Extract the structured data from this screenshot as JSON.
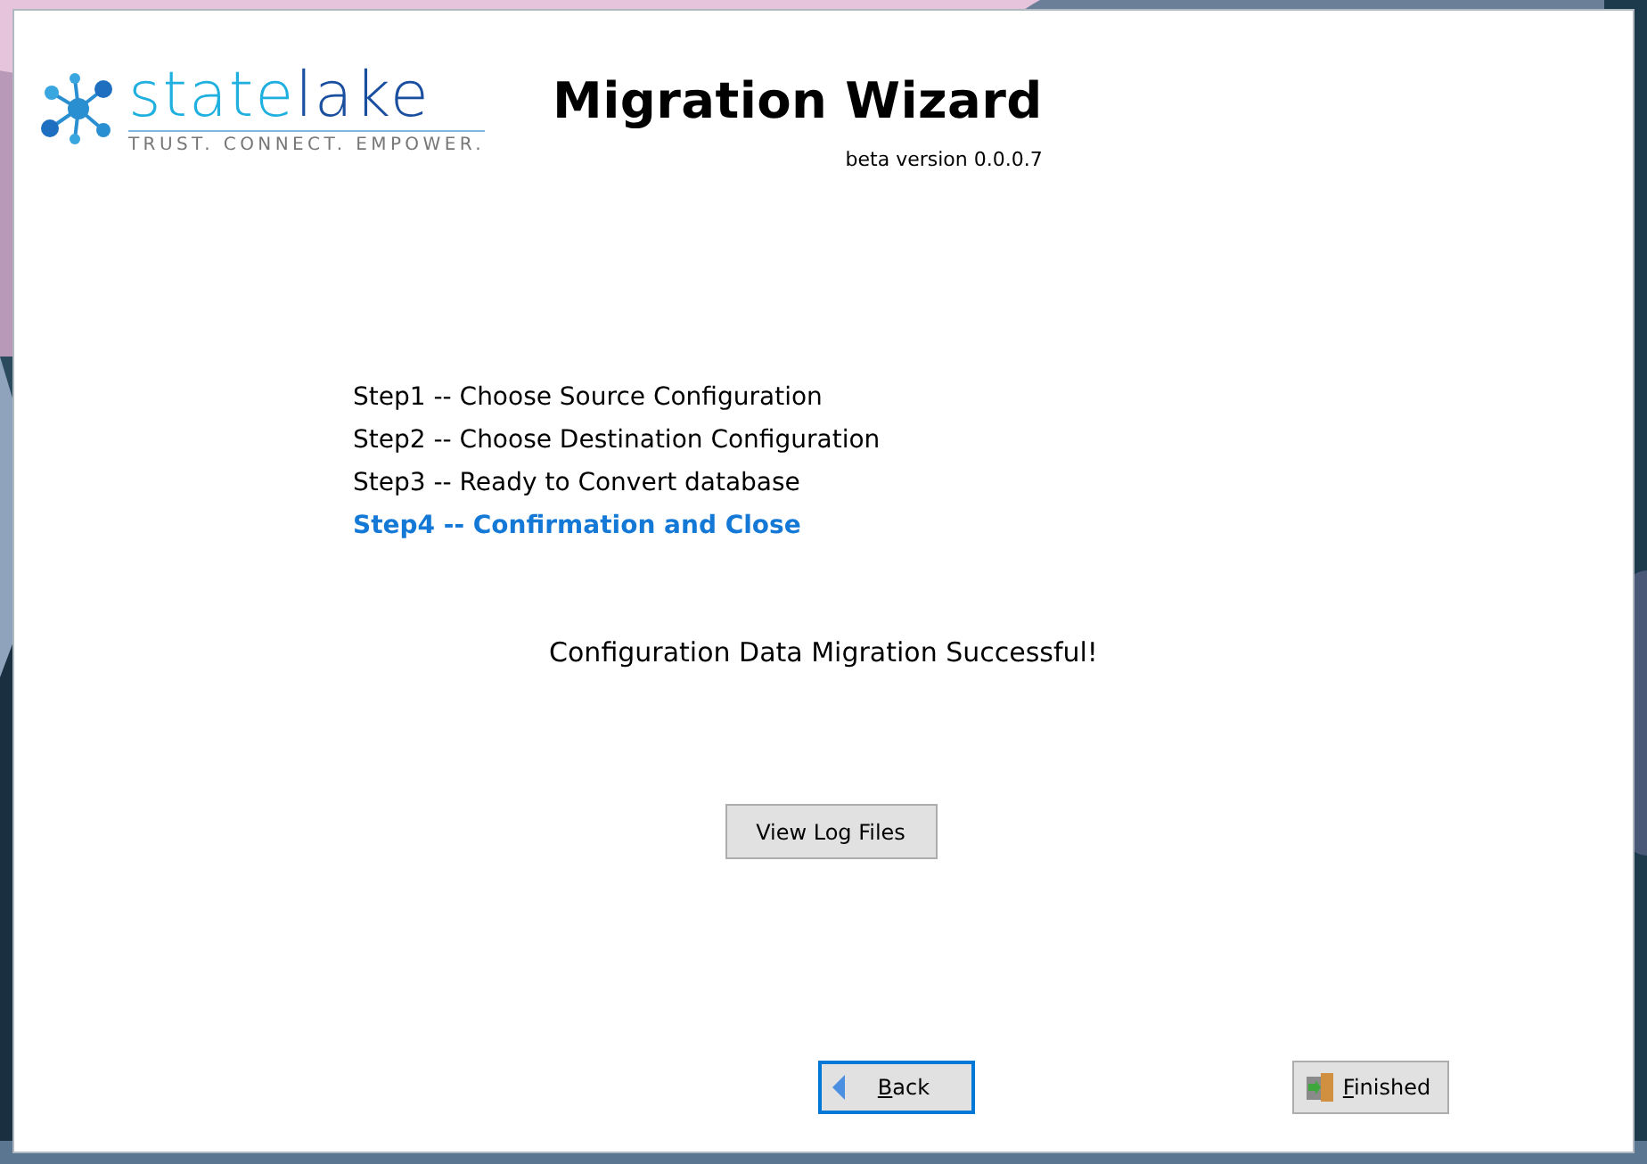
{
  "logo": {
    "wordmark": [
      "state",
      "lake"
    ],
    "tagline": "TRUST. CONNECT. EMPOWER."
  },
  "title": "Migration Wizard",
  "version": "beta version 0.0.0.7",
  "steps": [
    {
      "label": "Step1 -- Choose Source Configuration",
      "selected": false
    },
    {
      "label": "Step2 -- Choose Destination Configuration",
      "selected": false
    },
    {
      "label": "Step3 -- Ready to Convert database",
      "selected": false
    },
    {
      "label": "Step4 -- Confirmation and Close",
      "selected": true
    }
  ],
  "message": "Configuration Data Migration Successful!",
  "log_button": "View Log Files",
  "nav_buttons": [
    {
      "kind": "back",
      "label": "Back",
      "focused": true
    },
    {
      "kind": "finish",
      "label": "Finished",
      "focused": false
    }
  ]
}
